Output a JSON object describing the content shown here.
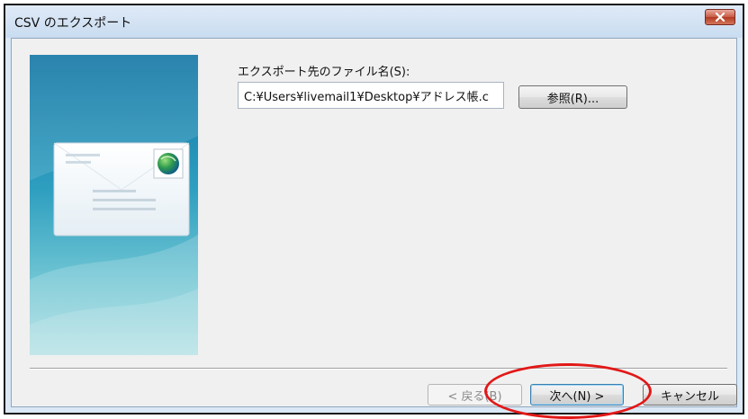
{
  "window": {
    "title": "CSV のエクスポート"
  },
  "export": {
    "field_label": "エクスポート先のファイル名(S):",
    "path_value": "C:¥Users¥livemail1¥Desktop¥アドレス帳.c",
    "browse_label": "参照(R)..."
  },
  "footer": {
    "back_label": "< 戻る(B)",
    "next_label": "次へ(N) >",
    "cancel_label": "キャンセル"
  },
  "icons": {
    "close": "close-icon",
    "envelope": "envelope-icon",
    "globe": "globe-icon"
  },
  "colors": {
    "highlight": "#e21818",
    "close_button": "#c75a43"
  }
}
